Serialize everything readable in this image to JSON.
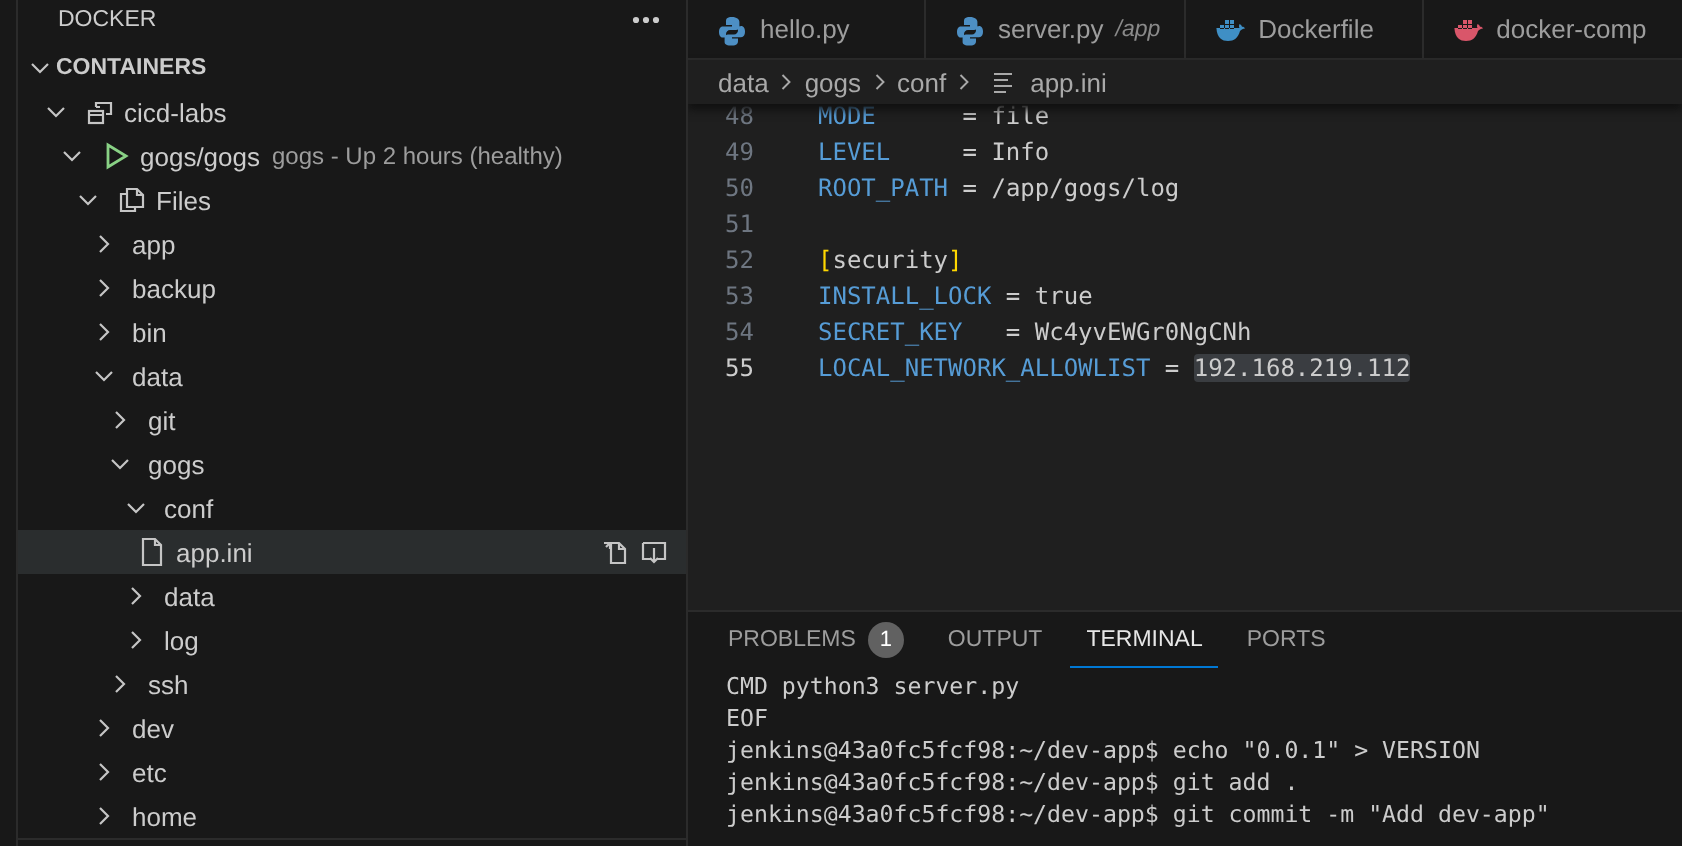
{
  "sidebar": {
    "title": "DOCKER",
    "sections": [
      {
        "label": "CONTAINERS",
        "expanded": true,
        "items": [
          {
            "kind": "group",
            "label": "cicd-labs",
            "expanded": true,
            "selected": false,
            "children": [
              {
                "kind": "container",
                "label": "gogs/gogs",
                "description": "gogs - Up 2 hours (healthy)",
                "expanded": true,
                "selected": false,
                "children": [
                  {
                    "kind": "files",
                    "label": "Files",
                    "expanded": true,
                    "selected": false,
                    "children": [
                      {
                        "kind": "folder",
                        "label": "app",
                        "expanded": false,
                        "selected": false
                      },
                      {
                        "kind": "folder",
                        "label": "backup",
                        "expanded": false,
                        "selected": false
                      },
                      {
                        "kind": "folder",
                        "label": "bin",
                        "expanded": false,
                        "selected": false
                      },
                      {
                        "kind": "folder",
                        "label": "data",
                        "expanded": true,
                        "selected": false,
                        "children": [
                          {
                            "kind": "folder",
                            "label": "git",
                            "expanded": false,
                            "selected": false
                          },
                          {
                            "kind": "folder",
                            "label": "gogs",
                            "expanded": true,
                            "selected": false,
                            "children": [
                              {
                                "kind": "folder",
                                "label": "conf",
                                "expanded": true,
                                "selected": false,
                                "children": [
                                  {
                                    "kind": "file",
                                    "label": "app.ini",
                                    "selected": true
                                  }
                                ]
                              },
                              {
                                "kind": "folder",
                                "label": "data",
                                "expanded": false,
                                "selected": false
                              },
                              {
                                "kind": "folder",
                                "label": "log",
                                "expanded": false,
                                "selected": false
                              }
                            ]
                          },
                          {
                            "kind": "folder",
                            "label": "ssh",
                            "expanded": false,
                            "selected": false
                          }
                        ]
                      },
                      {
                        "kind": "folder",
                        "label": "dev",
                        "expanded": false,
                        "selected": false
                      },
                      {
                        "kind": "folder",
                        "label": "etc",
                        "expanded": false,
                        "selected": false
                      },
                      {
                        "kind": "folder",
                        "label": "home",
                        "expanded": false,
                        "selected": false
                      }
                    ]
                  }
                ]
              }
            ]
          }
        ]
      }
    ]
  },
  "editor": {
    "tabs": [
      {
        "kind": "python",
        "label": "hello.py"
      },
      {
        "kind": "python",
        "label": "server.py",
        "description": "/app"
      },
      {
        "kind": "docker",
        "label": "Dockerfile"
      },
      {
        "kind": "compose",
        "label": "docker-comp"
      }
    ],
    "breadcrumb": [
      "data",
      "gogs",
      "conf",
      "app.ini"
    ],
    "lines": [
      {
        "number": "48",
        "current": false,
        "tokens": [
          {
            "kind": "key",
            "text": "MODE"
          },
          {
            "kind": "op",
            "text": "      = "
          },
          {
            "kind": "value",
            "text": "file"
          }
        ]
      },
      {
        "number": "49",
        "current": false,
        "tokens": [
          {
            "kind": "key",
            "text": "LEVEL"
          },
          {
            "kind": "op",
            "text": "     = "
          },
          {
            "kind": "value",
            "text": "Info"
          }
        ]
      },
      {
        "number": "50",
        "current": false,
        "tokens": [
          {
            "kind": "key",
            "text": "ROOT_PATH"
          },
          {
            "kind": "op",
            "text": " = "
          },
          {
            "kind": "value",
            "text": "/app/gogs/log"
          }
        ]
      },
      {
        "number": "51",
        "current": false
      },
      {
        "number": "52",
        "current": false,
        "tokens": [
          {
            "kind": "bracket",
            "text": "["
          },
          {
            "kind": "value",
            "text": "security"
          },
          {
            "kind": "bracket",
            "text": "]"
          }
        ]
      },
      {
        "number": "53",
        "current": false,
        "tokens": [
          {
            "kind": "key",
            "text": "INSTALL_LOCK"
          },
          {
            "kind": "op",
            "text": " = "
          },
          {
            "kind": "value",
            "text": "true"
          }
        ]
      },
      {
        "number": "54",
        "current": false,
        "tokens": [
          {
            "kind": "key",
            "text": "SECRET_KEY"
          },
          {
            "kind": "op",
            "text": "   = "
          },
          {
            "kind": "value",
            "text": "Wc4yvEWGr0NgCNh"
          }
        ]
      },
      {
        "number": "55",
        "current": true,
        "tokens": [
          {
            "kind": "key",
            "text": "LOCAL_NETWORK_ALLOWLIST"
          },
          {
            "kind": "op",
            "text": " = "
          },
          {
            "kind": "highlight",
            "text": "192.168.219.112"
          }
        ]
      }
    ]
  },
  "panel": {
    "tabs": [
      {
        "label": "PROBLEMS",
        "badge": "1",
        "selected": false
      },
      {
        "label": "OUTPUT",
        "selected": false
      },
      {
        "label": "TERMINAL",
        "selected": true
      },
      {
        "label": "PORTS",
        "selected": false
      }
    ],
    "terminal": [
      "CMD python3 server.py",
      "EOF",
      "jenkins@43a0fc5fcf98:~/dev-app$ echo \"0.0.1\" > VERSION",
      "jenkins@43a0fc5fcf98:~/dev-app$ git add .",
      "jenkins@43a0fc5fcf98:~/dev-app$ git commit -m \"Add dev-app\""
    ]
  }
}
